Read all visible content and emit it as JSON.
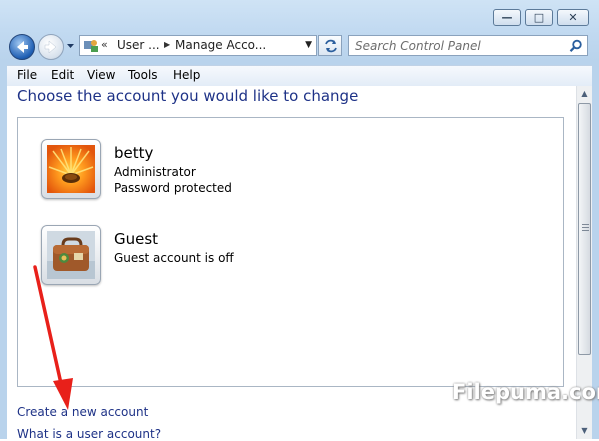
{
  "window": {
    "caption_buttons": [
      "minimize",
      "maximize",
      "close"
    ]
  },
  "address_bar": {
    "prefix": "«",
    "segments": [
      "User ...",
      "Manage Acco..."
    ]
  },
  "search": {
    "placeholder": "Search Control Panel"
  },
  "menu": {
    "items": [
      "File",
      "Edit",
      "View",
      "Tools",
      "Help"
    ]
  },
  "content": {
    "heading": "Choose the account you would like to change",
    "accounts": [
      {
        "name": "betty",
        "line1": "Administrator",
        "line2": "Password protected",
        "picture": "flower-picture"
      },
      {
        "name": "Guest",
        "line1": "Guest account is off",
        "picture": "briefcase-picture"
      }
    ],
    "links": [
      "Create a new account",
      "What is a user account?"
    ]
  },
  "annotation": {
    "arrow_color": "#e8201a"
  },
  "watermark": "Filepuma.com",
  "colors": {
    "link": "#1e3287",
    "frame": "#b9d3ec"
  }
}
